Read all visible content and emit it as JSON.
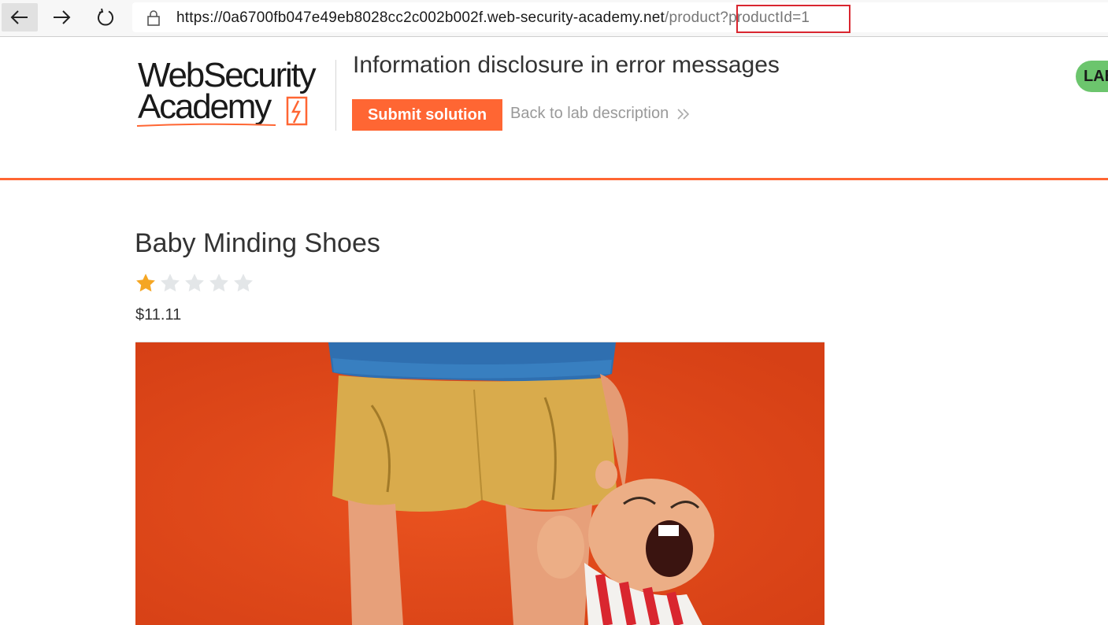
{
  "browser": {
    "back_icon": "arrow-left-icon",
    "forward_icon": "arrow-right-icon",
    "reload_icon": "reload-icon",
    "lock_icon": "lock-icon",
    "url_base": "https://0a6700fb047e49eb8028cc2c002b002f.web-security-academy.net",
    "url_path": "/product",
    "url_query": "?productId=1"
  },
  "header": {
    "logo_line1": "WebSecurity",
    "logo_line2": "Academy",
    "lab_title": "Information disclosure in error messages",
    "submit_label": "Submit solution",
    "back_label": "Back to lab description",
    "lab_status_label": "LAB",
    "accent_color": "#ff6633",
    "status_color": "#6cc56d"
  },
  "product": {
    "name": "Baby Minding Shoes",
    "rating": 1,
    "rating_max": 5,
    "price": "$11.11",
    "image_description": "clay figurine of a crying baby clinging to an adult's leg on an orange background"
  }
}
